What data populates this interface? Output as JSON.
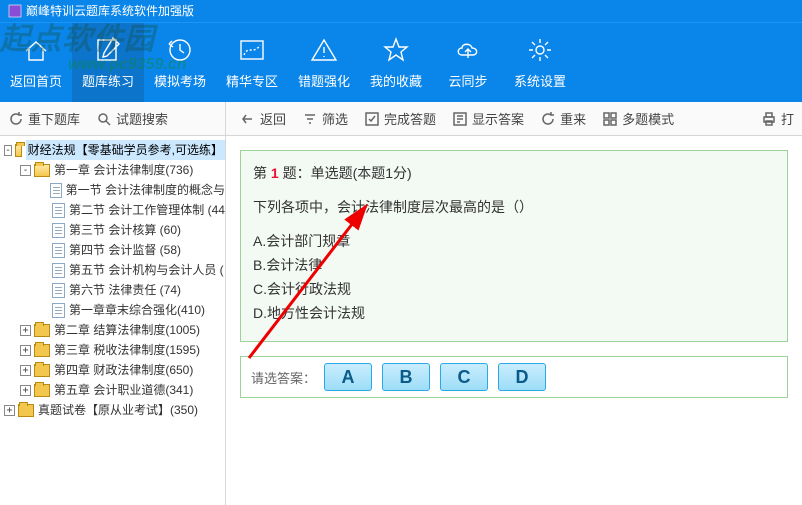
{
  "title": "巅峰特训云题库系统软件加强版",
  "watermark": "起点软件园",
  "watermark_url": "www.pc9359.cn",
  "topnav": [
    {
      "label": "返回首页"
    },
    {
      "label": "题库练习"
    },
    {
      "label": "模拟考场"
    },
    {
      "label": "精华专区"
    },
    {
      "label": "错题强化"
    },
    {
      "label": "我的收藏"
    },
    {
      "label": "云同步"
    },
    {
      "label": "系统设置"
    }
  ],
  "subbar_left": [
    {
      "label": "重下题库"
    },
    {
      "label": "试题搜索"
    }
  ],
  "subbar_right": [
    {
      "label": "返回"
    },
    {
      "label": "筛选"
    },
    {
      "label": "完成答题"
    },
    {
      "label": "显示答案"
    },
    {
      "label": "重来"
    },
    {
      "label": "多题模式"
    }
  ],
  "subbar_extra": "打",
  "tree": [
    {
      "depth": 0,
      "toggle": "-",
      "icon": "folder-open",
      "label": "财经法规【零基础学员参考,可选练】",
      "sel": true
    },
    {
      "depth": 1,
      "toggle": "-",
      "icon": "folder-open",
      "label": "第一章  会计法律制度(736)"
    },
    {
      "depth": 2,
      "toggle": "",
      "icon": "page",
      "label": "第一节  会计法律制度的概念与"
    },
    {
      "depth": 2,
      "toggle": "",
      "icon": "page",
      "label": "第二节  会计工作管理体制  (44"
    },
    {
      "depth": 2,
      "toggle": "",
      "icon": "page",
      "label": "第三节  会计核算  (60)"
    },
    {
      "depth": 2,
      "toggle": "",
      "icon": "page",
      "label": "第四节  会计监督  (58)"
    },
    {
      "depth": 2,
      "toggle": "",
      "icon": "page",
      "label": "第五节  会计机构与会计人员  ("
    },
    {
      "depth": 2,
      "toggle": "",
      "icon": "page",
      "label": "第六节  法律责任  (74)"
    },
    {
      "depth": 2,
      "toggle": "",
      "icon": "page",
      "label": "第一章章末综合强化(410)"
    },
    {
      "depth": 1,
      "toggle": "+",
      "icon": "folder",
      "label": "第二章  结算法律制度(1005)"
    },
    {
      "depth": 1,
      "toggle": "+",
      "icon": "folder",
      "label": "第三章  税收法律制度(1595)"
    },
    {
      "depth": 1,
      "toggle": "+",
      "icon": "folder",
      "label": "第四章  财政法律制度(650)"
    },
    {
      "depth": 1,
      "toggle": "+",
      "icon": "folder",
      "label": "第五章  会计职业道德(341)"
    },
    {
      "depth": 0,
      "toggle": "+",
      "icon": "folder",
      "label": "真题试卷【原从业考试】(350)"
    }
  ],
  "question": {
    "prefix": "第 ",
    "number": "1",
    "suffix": " 题：单选题(本题1分)",
    "stem": "下列各项中，会计法律制度层次最高的是（）",
    "options": [
      "A.会计部门规章",
      "B.会计法律",
      "C.会计行政法规",
      "D.地方性会计法规"
    ]
  },
  "answer_prompt": "请选答案：",
  "answer_buttons": [
    "A",
    "B",
    "C",
    "D"
  ]
}
